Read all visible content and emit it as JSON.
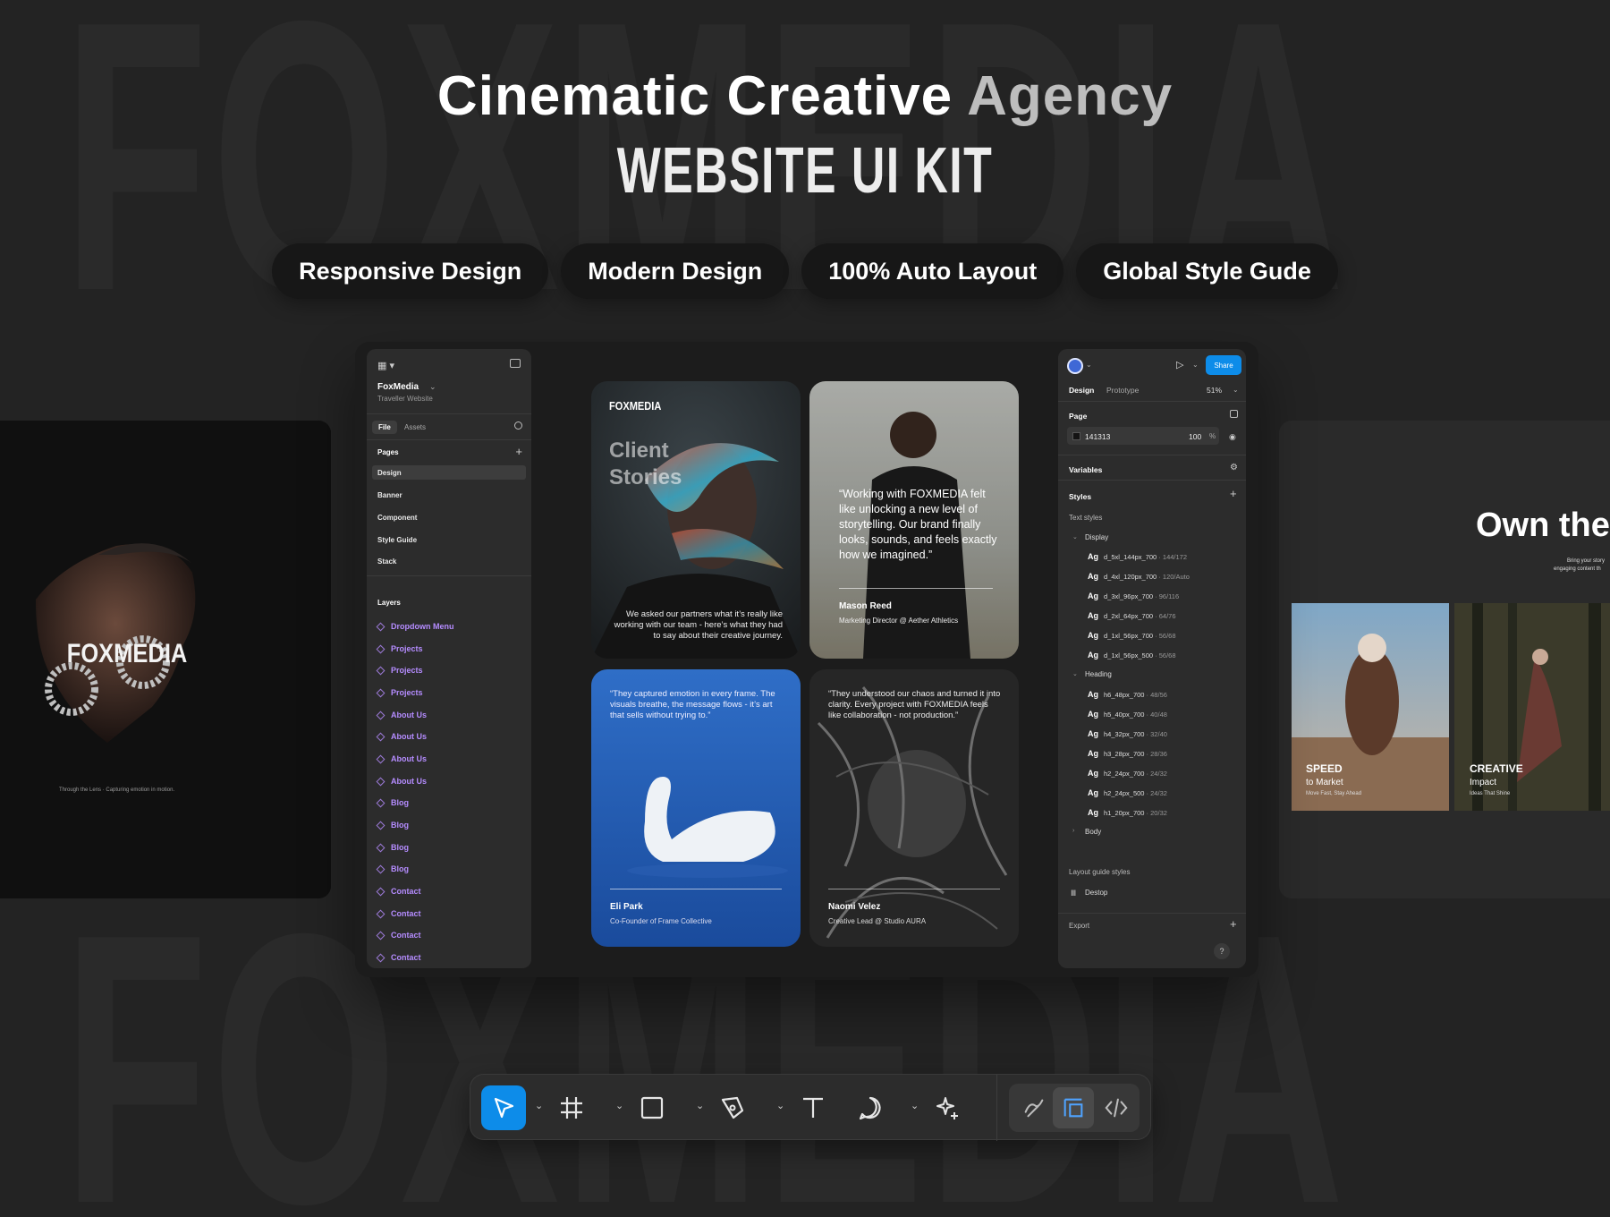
{
  "background_word": "FOXMEDIA",
  "hero": {
    "title_a": "Cinematic Creative ",
    "title_b": "Agency",
    "subtitle": "WEBSITE UI KIT",
    "pills": [
      "Responsive Design",
      "Modern Design",
      "100% Auto Layout",
      "Global Style Gude"
    ]
  },
  "left_card": {
    "logo": "FOXMEDIA",
    "caption": "Through the Lens · Capturing emotion in motion."
  },
  "right_card": {
    "heading": "Own the",
    "tag1": "Bring your story",
    "tag2": "engaging content th",
    "img1_t1": "SPEED",
    "img1_t2": "to Market",
    "img1_t3": "Move Fast, Stay Ahead",
    "img2_t1": "CREATIVE",
    "img2_t2": "Impact",
    "img2_t3": "Ideas That Shine"
  },
  "left_panel": {
    "project": "FoxMedia",
    "project_sub": "Traveller Website",
    "tab_file": "File",
    "tab_assets": "Assets",
    "pages_label": "Pages",
    "pages": [
      "Design",
      "Banner",
      "Component",
      "Style Guide",
      "Stack"
    ],
    "layers_label": "Layers",
    "layers": [
      "Dropdown Menu",
      "Projects",
      "Projects",
      "Projects",
      "About Us",
      "About Us",
      "About Us",
      "About Us",
      "Blog",
      "Blog",
      "Blog",
      "Blog",
      "Contact",
      "Contact",
      "Contact",
      "Contact"
    ]
  },
  "cards": {
    "c1_logo": "FOXMEDIA",
    "c1_title1": "Client",
    "c1_title2": "Stories",
    "c1_body": "We asked our partners what it’s really like working with our team - here’s what they had to say about their creative journey.",
    "c2_quote": "“Working with FOXMEDIA felt like unlocking a new level of storytelling. Our brand finally looks, sounds, and feels exactly how we imagined.”",
    "c2_name": "Mason Reed",
    "c2_role": "Marketing Director @ Aether Athletics",
    "c3_quote": "“They captured emotion in every frame. The visuals breathe, the message flows - it’s art that sells without trying to.”",
    "c3_name": "Eli Park",
    "c3_role": "Co-Founder of Frame Collective",
    "c4_quote": "“They understood our chaos and turned it into clarity. Every project with FOXMEDIA feels like collaboration - not production.”",
    "c4_name": "Naomi Velez",
    "c4_role": "Creative Lead @ Studio AURA"
  },
  "right_panel": {
    "share": "Share",
    "tab_design": "Design",
    "tab_prototype": "Prototype",
    "zoom": "51%",
    "page_label": "Page",
    "page_color": "141313",
    "page_opacity": "100",
    "pct": "%",
    "variables": "Variables",
    "styles": "Styles",
    "text_styles": "Text styles",
    "display": "Display",
    "display_items": [
      [
        "d_5xl_144px_700",
        "144/172"
      ],
      [
        "d_4xl_120px_700",
        "120/Auto"
      ],
      [
        "d_3xl_96px_700",
        "96/116"
      ],
      [
        "d_2xl_64px_700",
        "64/76"
      ],
      [
        "d_1xl_56px_700",
        "56/68"
      ],
      [
        "d_1xl_56px_500",
        "56/68"
      ]
    ],
    "heading": "Heading",
    "heading_items": [
      [
        "h6_48px_700",
        "48/56"
      ],
      [
        "h5_40px_700",
        "40/48"
      ],
      [
        "h4_32px_700",
        "32/40"
      ],
      [
        "h3_28px_700",
        "28/36"
      ],
      [
        "h2_24px_700",
        "24/32"
      ],
      [
        "h2_24px_500",
        "24/32"
      ],
      [
        "h1_20px_700",
        "20/32"
      ]
    ],
    "ag": "Ag",
    "body": "Body",
    "layout_guides": "Layout guide styles",
    "desktop": "Destop",
    "export": "Export",
    "help": "?"
  },
  "colors": {
    "accent": "#0d8ce9",
    "layer_purple": "#b58cff"
  }
}
